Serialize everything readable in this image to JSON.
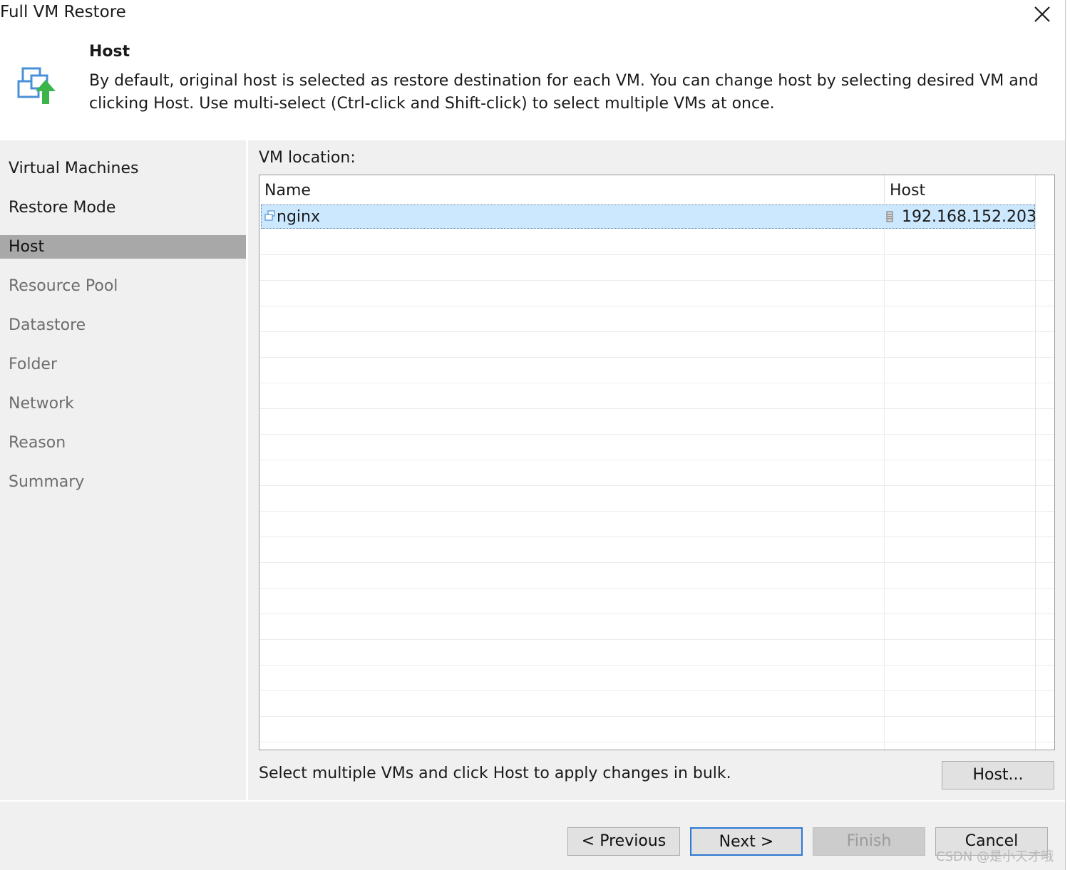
{
  "window": {
    "title": "Full VM Restore",
    "close_icon": "close-icon"
  },
  "header": {
    "title": "Host",
    "description": "By default, original host is selected as restore destination for each VM. You can change host by selecting desired VM and clicking Host. Use multi-select (Ctrl-click and Shift-click) to select multiple VMs at once.",
    "icon": "restore-vm-icon"
  },
  "nav": {
    "items": [
      {
        "label": "Virtual Machines",
        "state": "done"
      },
      {
        "label": "Restore Mode",
        "state": "done"
      },
      {
        "label": "Host",
        "state": "active"
      },
      {
        "label": "Resource Pool",
        "state": "todo"
      },
      {
        "label": "Datastore",
        "state": "todo"
      },
      {
        "label": "Folder",
        "state": "todo"
      },
      {
        "label": "Network",
        "state": "todo"
      },
      {
        "label": "Reason",
        "state": "todo"
      },
      {
        "label": "Summary",
        "state": "todo"
      }
    ]
  },
  "main": {
    "location_label": "VM location:",
    "columns": [
      "Name",
      "Host"
    ],
    "rows": [
      {
        "name": "nginx",
        "host": "192.168.152.203",
        "selected": true,
        "name_icon": "vm-icon",
        "host_icon": "host-server-icon"
      }
    ],
    "bulk_hint": "Select multiple VMs and click Host to apply changes in bulk.",
    "host_button": "Host..."
  },
  "footer": {
    "previous": "< Previous",
    "next": "Next >",
    "finish": "Finish",
    "cancel": "Cancel"
  },
  "watermark": "CSDN @是小天才哦",
  "colors": {
    "selection": "#cce8ff",
    "active_nav": "#a8a8a8",
    "panel": "#f0f0f0",
    "default_button_border": "#2c78d4",
    "icon_green": "#3bb54a",
    "icon_blue": "#4a90d9"
  }
}
